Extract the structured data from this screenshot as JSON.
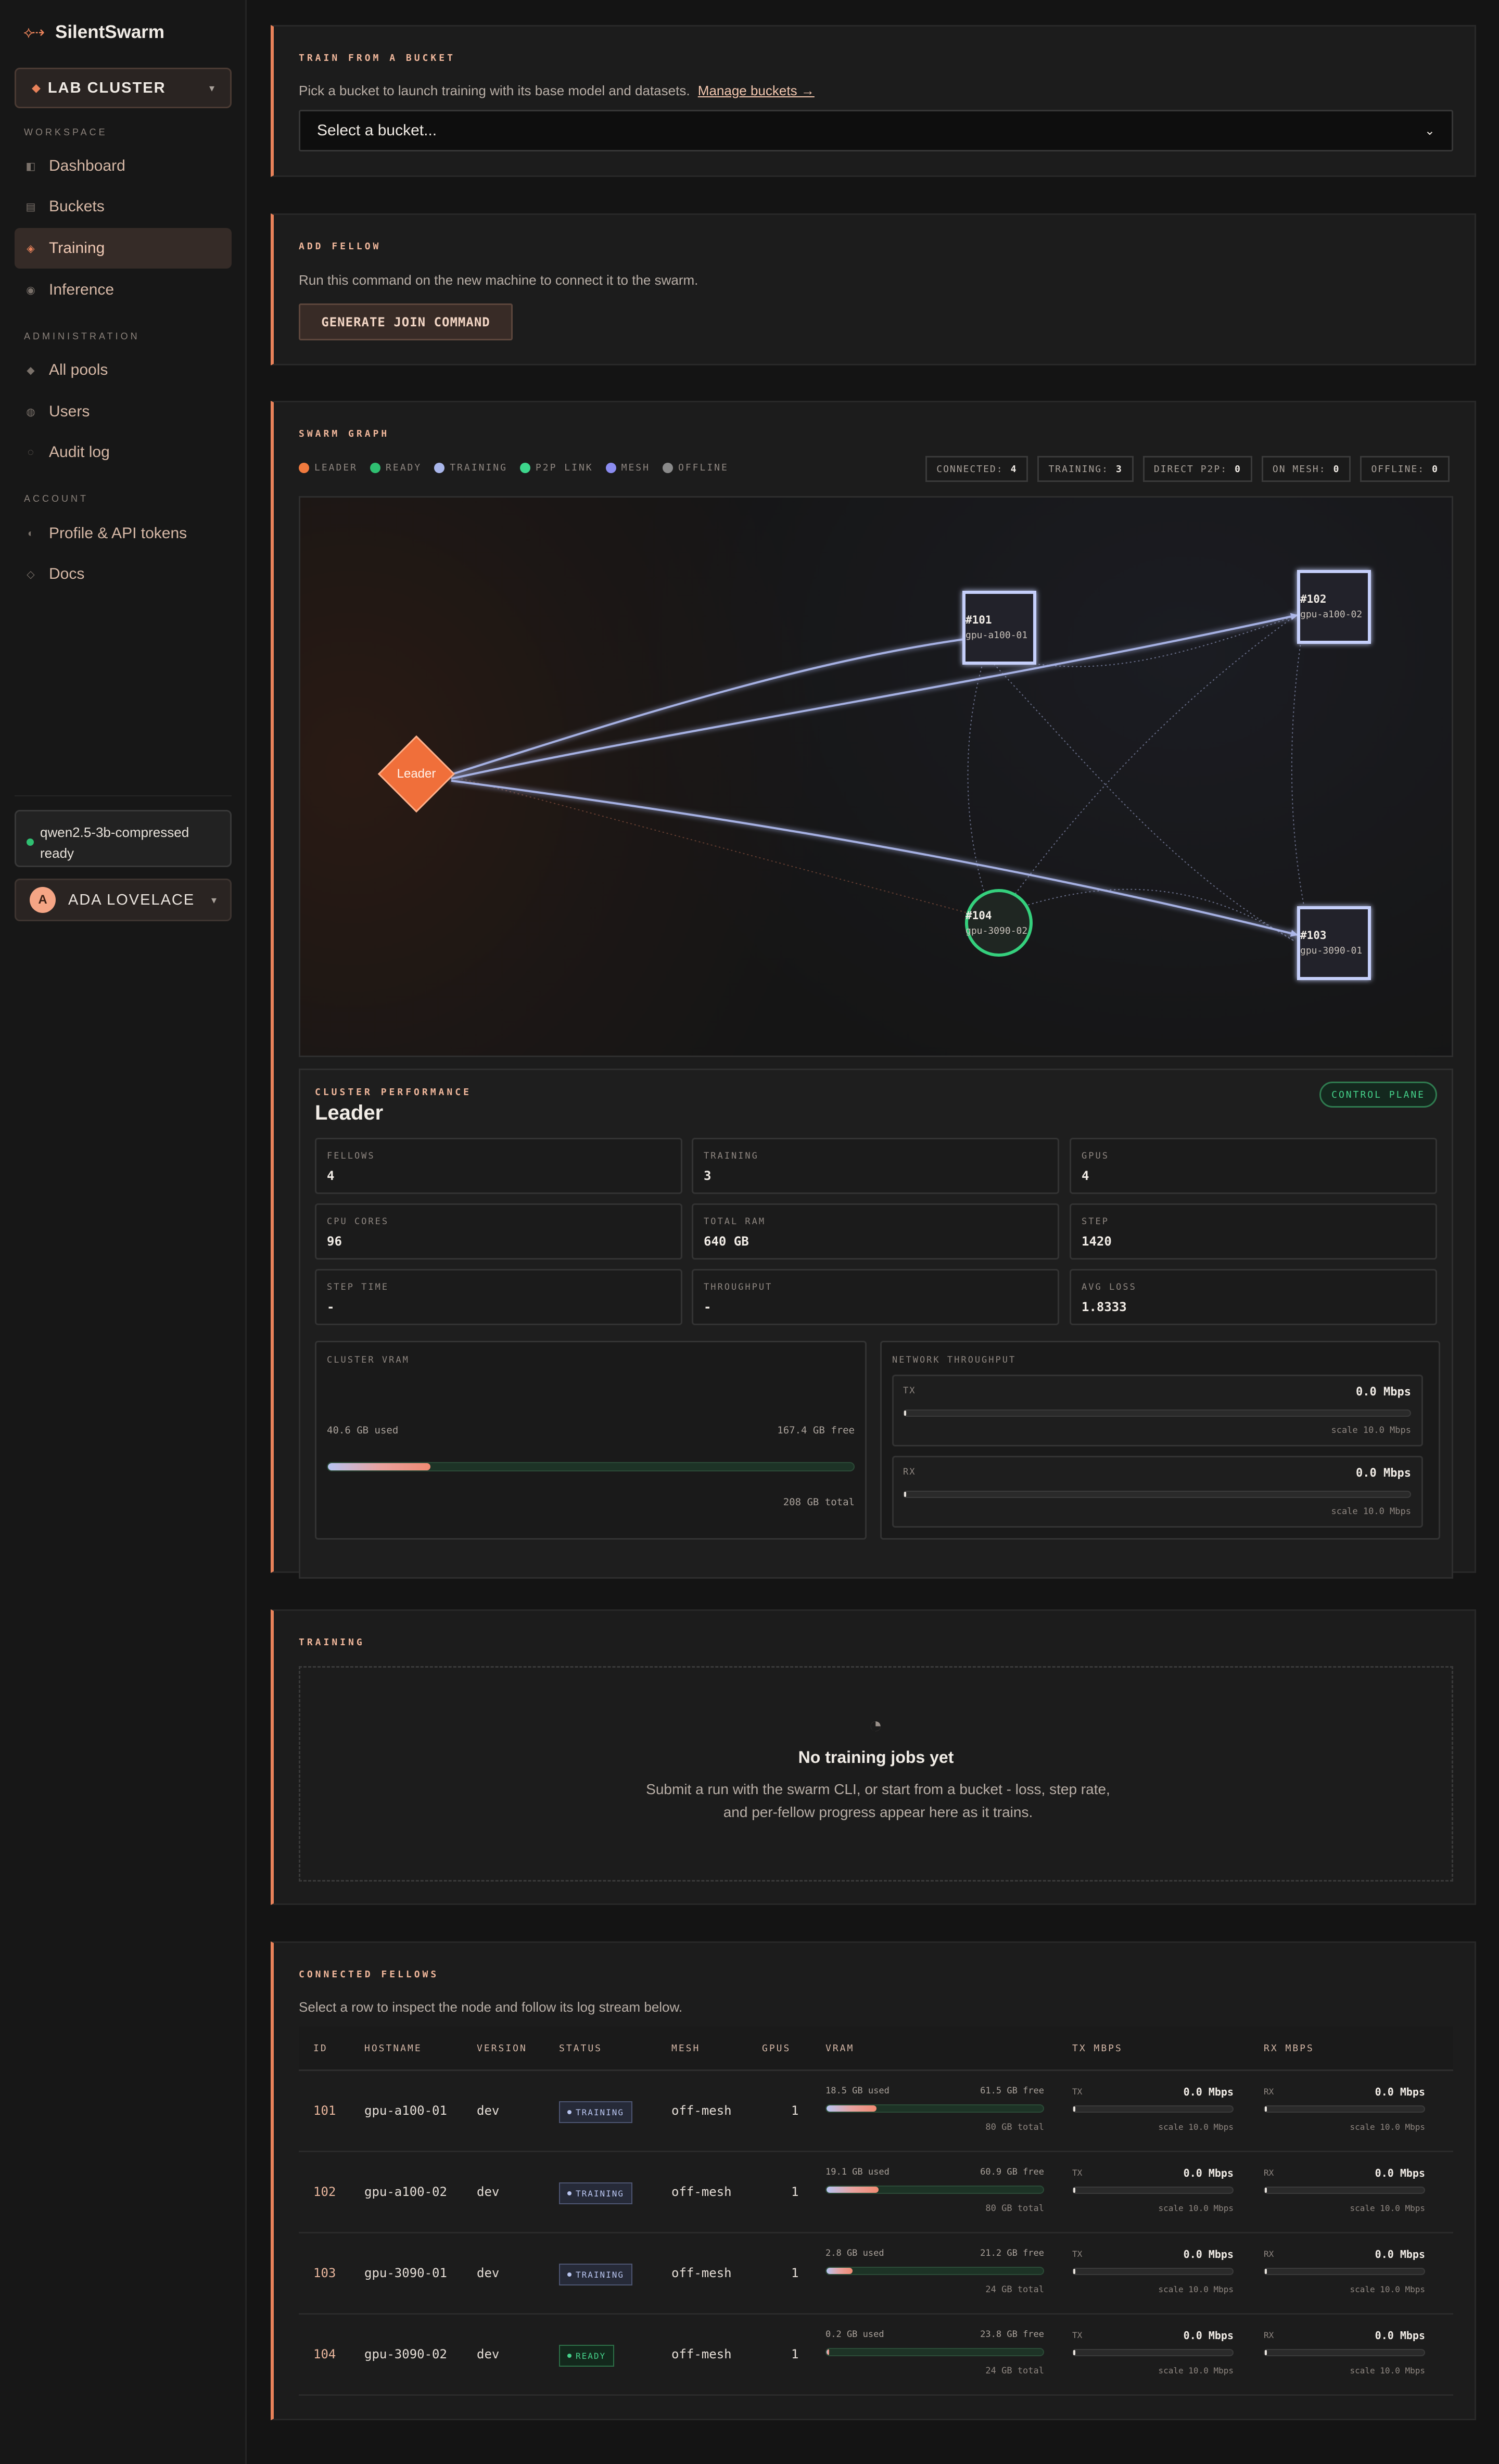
{
  "app": {
    "name": "SilentSwarm"
  },
  "sidebar": {
    "cluster": "LAB CLUSTER",
    "sections": {
      "workspace": "WORKSPACE",
      "administration": "ADMINISTRATION",
      "account": "ACCOUNT"
    },
    "workspace": [
      "Dashboard",
      "Buckets",
      "Training",
      "Inference"
    ],
    "administration": [
      "All pools",
      "Users",
      "Audit log"
    ],
    "account": [
      "Profile & API tokens",
      "Docs"
    ],
    "active": "Training",
    "model": {
      "name": "qwen2.5-3b-compressed",
      "status": "ready"
    },
    "user": {
      "initial": "A",
      "name": "ADA LOVELACE"
    }
  },
  "train_bucket": {
    "title": "TRAIN FROM A BUCKET",
    "desc": "Pick a bucket to launch training with its base model and datasets.",
    "link": "Manage buckets →",
    "placeholder": "Select a bucket..."
  },
  "add_fellow": {
    "title": "ADD FELLOW",
    "desc": "Run this command on the new machine to connect it to the swarm.",
    "button": "GENERATE JOIN COMMAND"
  },
  "swarm": {
    "title": "SWARM GRAPH",
    "legend": [
      {
        "label": "LEADER",
        "color": "#f07a3e"
      },
      {
        "label": "READY",
        "color": "#2fbf71"
      },
      {
        "label": "TRAINING",
        "color": "#a9b6ea"
      },
      {
        "label": "P2P LINK",
        "color": "#3dd68c"
      },
      {
        "label": "MESH",
        "color": "#8b8cf0"
      },
      {
        "label": "OFFLINE",
        "color": "#8a8a8a"
      }
    ],
    "stats": [
      {
        "label": "CONNECTED:",
        "value": "4"
      },
      {
        "label": "TRAINING:",
        "value": "3"
      },
      {
        "label": "DIRECT P2P:",
        "value": "0"
      },
      {
        "label": "ON MESH:",
        "value": "0"
      },
      {
        "label": "OFFLINE:",
        "value": "0"
      }
    ],
    "nodes": {
      "leader": "Leader",
      "n101": {
        "id": "#101",
        "host": "gpu-a100-01"
      },
      "n102": {
        "id": "#102",
        "host": "gpu-a100-02"
      },
      "n103": {
        "id": "#103",
        "host": "gpu-3090-01"
      },
      "n104": {
        "id": "#104",
        "host": "gpu-3090-02"
      }
    }
  },
  "performance": {
    "kicker": "CLUSTER PERFORMANCE",
    "title": "Leader",
    "badge": "CONTROL PLANE",
    "metrics": [
      {
        "label": "FELLOWS",
        "value": "4"
      },
      {
        "label": "TRAINING",
        "value": "3"
      },
      {
        "label": "GPUS",
        "value": "4"
      },
      {
        "label": "CPU CORES",
        "value": "96"
      },
      {
        "label": "TOTAL RAM",
        "value": "640 GB"
      },
      {
        "label": "STEP",
        "value": "1420"
      },
      {
        "label": "STEP TIME",
        "value": "-"
      },
      {
        "label": "THROUGHPUT",
        "value": "-"
      },
      {
        "label": "AVG LOSS",
        "value": "1.8333"
      }
    ],
    "vram": {
      "label": "CLUSTER VRAM",
      "used": "40.6 GB used",
      "free": "167.4 GB free",
      "total": "208 GB total",
      "fraction": 0.195
    },
    "network": {
      "label": "NETWORK THROUGHPUT",
      "tx": {
        "label": "TX",
        "value": "0.0 Mbps",
        "scale": "scale 10.0 Mbps"
      },
      "rx": {
        "label": "RX",
        "value": "0.0 Mbps",
        "scale": "scale 10.0 Mbps"
      }
    }
  },
  "training": {
    "title": "TRAINING",
    "empty_title": "No training jobs yet",
    "empty_desc": "Submit a run with the swarm CLI, or start from a bucket - loss, step rate, and per-fellow progress appear here as it trains."
  },
  "fellows": {
    "title": "CONNECTED FELLOWS",
    "desc": "Select a row to inspect the node and follow its log stream below.",
    "columns": [
      "ID",
      "HOSTNAME",
      "VERSION",
      "STATUS",
      "MESH",
      "GPUS",
      "VRAM",
      "TX MBPS",
      "RX MBPS"
    ],
    "rows": [
      {
        "id": "101",
        "host": "gpu-a100-01",
        "version": "dev",
        "status": "TRAINING",
        "mesh": "off-mesh",
        "gpus": "1",
        "used": "18.5 GB used",
        "free": "61.5 GB free",
        "total": "80 GB total",
        "fraction": 0.23,
        "tx_label": "TX",
        "tx": "0.0 Mbps",
        "tx_scale": "scale 10.0 Mbps",
        "rx_label": "RX",
        "rx": "0.0 Mbps",
        "rx_scale": "scale 10.0 Mbps"
      },
      {
        "id": "102",
        "host": "gpu-a100-02",
        "version": "dev",
        "status": "TRAINING",
        "mesh": "off-mesh",
        "gpus": "1",
        "used": "19.1 GB used",
        "free": "60.9 GB free",
        "total": "80 GB total",
        "fraction": 0.24,
        "tx_label": "TX",
        "tx": "0.0 Mbps",
        "tx_scale": "scale 10.0 Mbps",
        "rx_label": "RX",
        "rx": "0.0 Mbps",
        "rx_scale": "scale 10.0 Mbps"
      },
      {
        "id": "103",
        "host": "gpu-3090-01",
        "version": "dev",
        "status": "TRAINING",
        "mesh": "off-mesh",
        "gpus": "1",
        "used": "2.8 GB used",
        "free": "21.2 GB free",
        "total": "24 GB total",
        "fraction": 0.12,
        "tx_label": "TX",
        "tx": "0.0 Mbps",
        "tx_scale": "scale 10.0 Mbps",
        "rx_label": "RX",
        "rx": "0.0 Mbps",
        "rx_scale": "scale 10.0 Mbps"
      },
      {
        "id": "104",
        "host": "gpu-3090-02",
        "version": "dev",
        "status": "READY",
        "mesh": "off-mesh",
        "gpus": "1",
        "used": "0.2 GB used",
        "free": "23.8 GB free",
        "total": "24 GB total",
        "fraction": 0.01,
        "tx_label": "TX",
        "tx": "0.0 Mbps",
        "tx_scale": "scale 10.0 Mbps",
        "rx_label": "RX",
        "rx": "0.0 Mbps",
        "rx_scale": "scale 10.0 Mbps"
      }
    ]
  }
}
